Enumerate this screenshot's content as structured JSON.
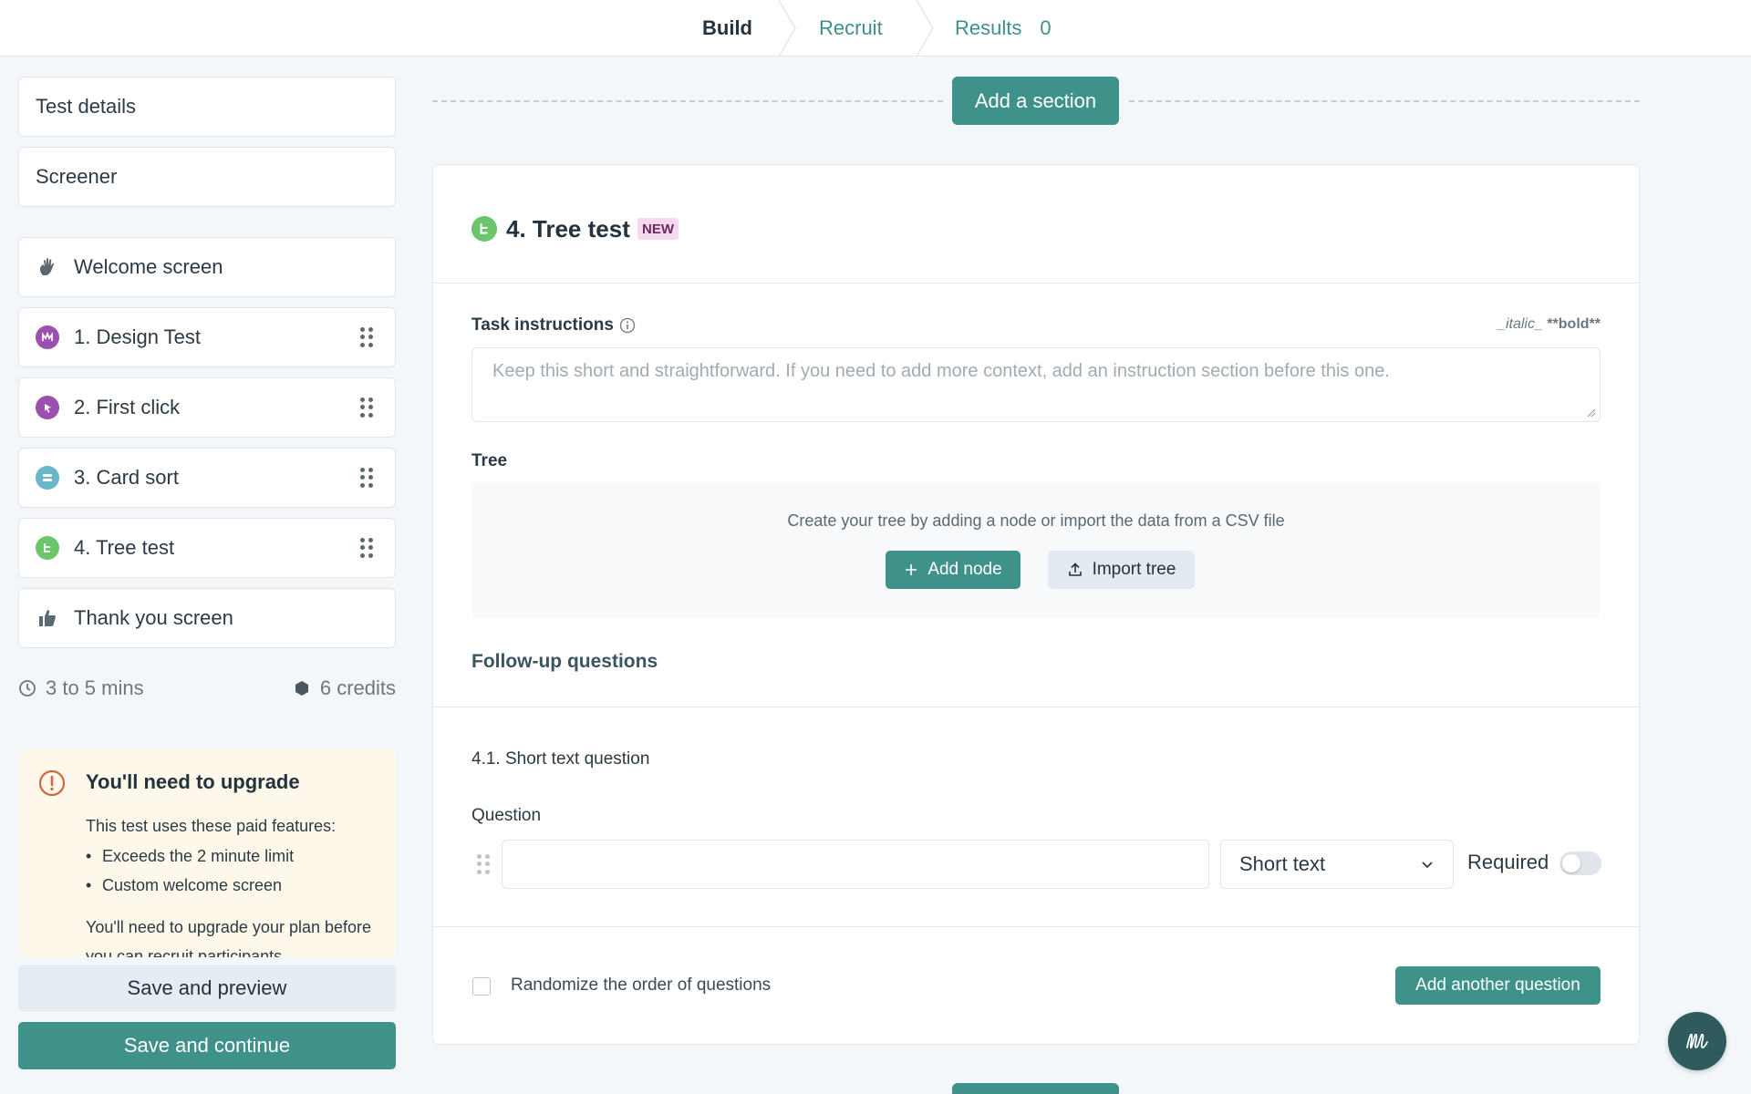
{
  "nav": {
    "steps": [
      {
        "label": "Build",
        "active": true
      },
      {
        "label": "Recruit",
        "active": false
      },
      {
        "label": "Results",
        "active": false
      }
    ],
    "results_count": "0"
  },
  "sidebar": {
    "items": [
      {
        "label": "Test details",
        "icon": ""
      },
      {
        "label": "Screener",
        "icon": ""
      },
      {
        "label": "Welcome screen",
        "icon": "hand-wave-icon"
      },
      {
        "label": "1. Design Test",
        "icon": "design-test-icon",
        "color": "#9b4fae"
      },
      {
        "label": "2. First click",
        "icon": "first-click-icon",
        "color": "#9b4fae"
      },
      {
        "label": "3. Card sort",
        "icon": "card-sort-icon",
        "color": "#6ab7c9"
      },
      {
        "label": "4. Tree test",
        "icon": "tree-test-icon",
        "color": "#6cc56b"
      },
      {
        "label": "Thank you screen",
        "icon": "thumbs-up-icon"
      }
    ],
    "duration": "3 to 5 mins",
    "credits": "6 credits",
    "upgrade": {
      "title": "You'll need to upgrade",
      "intro": "This test uses these paid features:",
      "features": [
        "Exceeds the 2 minute limit",
        "Custom welcome screen"
      ],
      "outro": "You'll need to upgrade your plan before you can recruit participants."
    },
    "save_preview_label": "Save and preview",
    "save_continue_label": "Save and continue"
  },
  "main": {
    "add_section_label": "Add a section",
    "section": {
      "title": "4. Tree test",
      "badge": "NEW",
      "task_label": "Task instructions",
      "markdown_hint_italic": "_italic_",
      "markdown_hint_bold": "**bold**",
      "task_placeholder": "Keep this short and straightforward. If you need to add more context, add an instruction section before this one.",
      "tree_label": "Tree",
      "tree_message": "Create your tree by adding a node or import the data from a CSV file",
      "add_node_label": "Add node",
      "import_tree_label": "Import tree",
      "followup_label": "Follow-up questions",
      "question": {
        "title": "4.1. Short text question",
        "label": "Question",
        "value": "",
        "type": "Short text",
        "required_label": "Required",
        "required": false
      },
      "randomize_label": "Randomize the order of questions",
      "add_question_label": "Add another question"
    }
  },
  "colors": {
    "accent": "#3e928a",
    "upgrade_bg": "#fdf8ea",
    "badge_bg": "#f6d8ef"
  }
}
